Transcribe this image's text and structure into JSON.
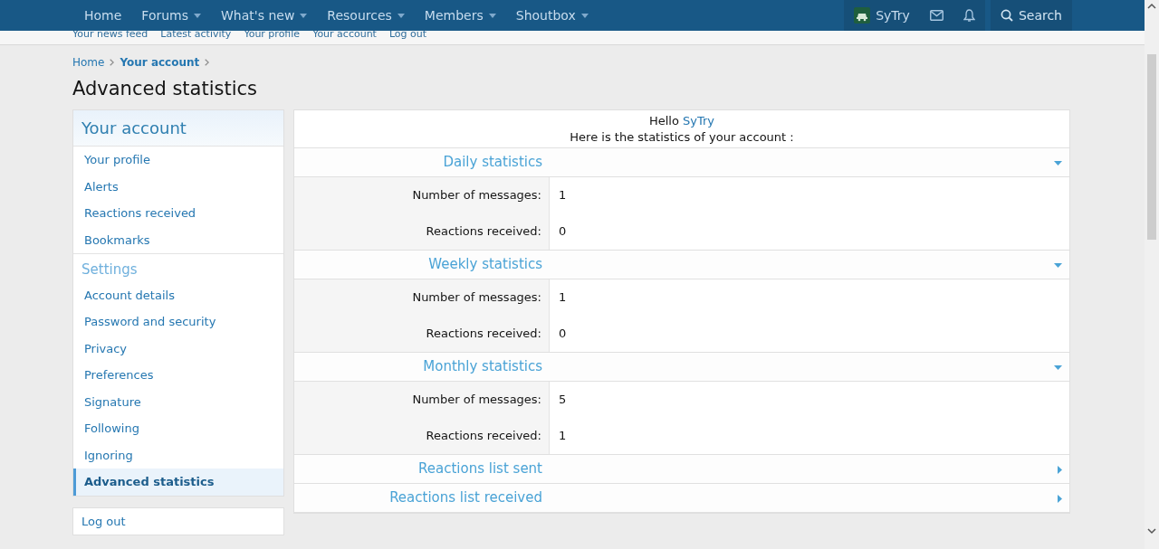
{
  "nav": {
    "items": [
      {
        "label": "Home",
        "has_menu": false
      },
      {
        "label": "Forums",
        "has_menu": true
      },
      {
        "label": "What's new",
        "has_menu": true
      },
      {
        "label": "Resources",
        "has_menu": true
      },
      {
        "label": "Members",
        "has_menu": true
      },
      {
        "label": "Shoutbox",
        "has_menu": true
      }
    ],
    "user": "SyTry",
    "search": "Search"
  },
  "subnav": [
    "Your news feed",
    "Latest activity",
    "Your profile",
    "Your account",
    "Log out"
  ],
  "breadcrumb": [
    {
      "label": "Home",
      "current": false
    },
    {
      "label": "Your account",
      "current": true
    }
  ],
  "title": "Advanced statistics",
  "sidebar": {
    "sections": [
      {
        "heading": "Your account",
        "kind": "primary",
        "items": [
          {
            "label": "Your profile",
            "selected": false
          },
          {
            "label": "Alerts",
            "selected": false
          },
          {
            "label": "Reactions received",
            "selected": false
          },
          {
            "label": "Bookmarks",
            "selected": false
          }
        ]
      },
      {
        "heading": "Settings",
        "kind": "secondary",
        "items": [
          {
            "label": "Account details",
            "selected": false
          },
          {
            "label": "Password and security",
            "selected": false
          },
          {
            "label": "Privacy",
            "selected": false
          },
          {
            "label": "Preferences",
            "selected": false
          },
          {
            "label": "Signature",
            "selected": false
          },
          {
            "label": "Following",
            "selected": false
          },
          {
            "label": "Ignoring",
            "selected": false
          },
          {
            "label": "Advanced statistics",
            "selected": true
          }
        ]
      }
    ],
    "logout": "Log out"
  },
  "main": {
    "greeting": "Hello",
    "username": "SyTry",
    "intro": "Here is the statistics of your account :",
    "sections": [
      {
        "title": "Daily statistics",
        "expanded": true,
        "rows": [
          {
            "label": "Number of messages:",
            "value": "1"
          },
          {
            "label": "Reactions received:",
            "value": "0"
          }
        ]
      },
      {
        "title": "Weekly statistics",
        "expanded": true,
        "rows": [
          {
            "label": "Number of messages:",
            "value": "1"
          },
          {
            "label": "Reactions received:",
            "value": "0"
          }
        ]
      },
      {
        "title": "Monthly statistics",
        "expanded": true,
        "rows": [
          {
            "label": "Number of messages:",
            "value": "5"
          },
          {
            "label": "Reactions received:",
            "value": "1"
          }
        ]
      },
      {
        "title": "Reactions list sent",
        "expanded": false
      },
      {
        "title": "Reactions list received",
        "expanded": false
      }
    ]
  }
}
